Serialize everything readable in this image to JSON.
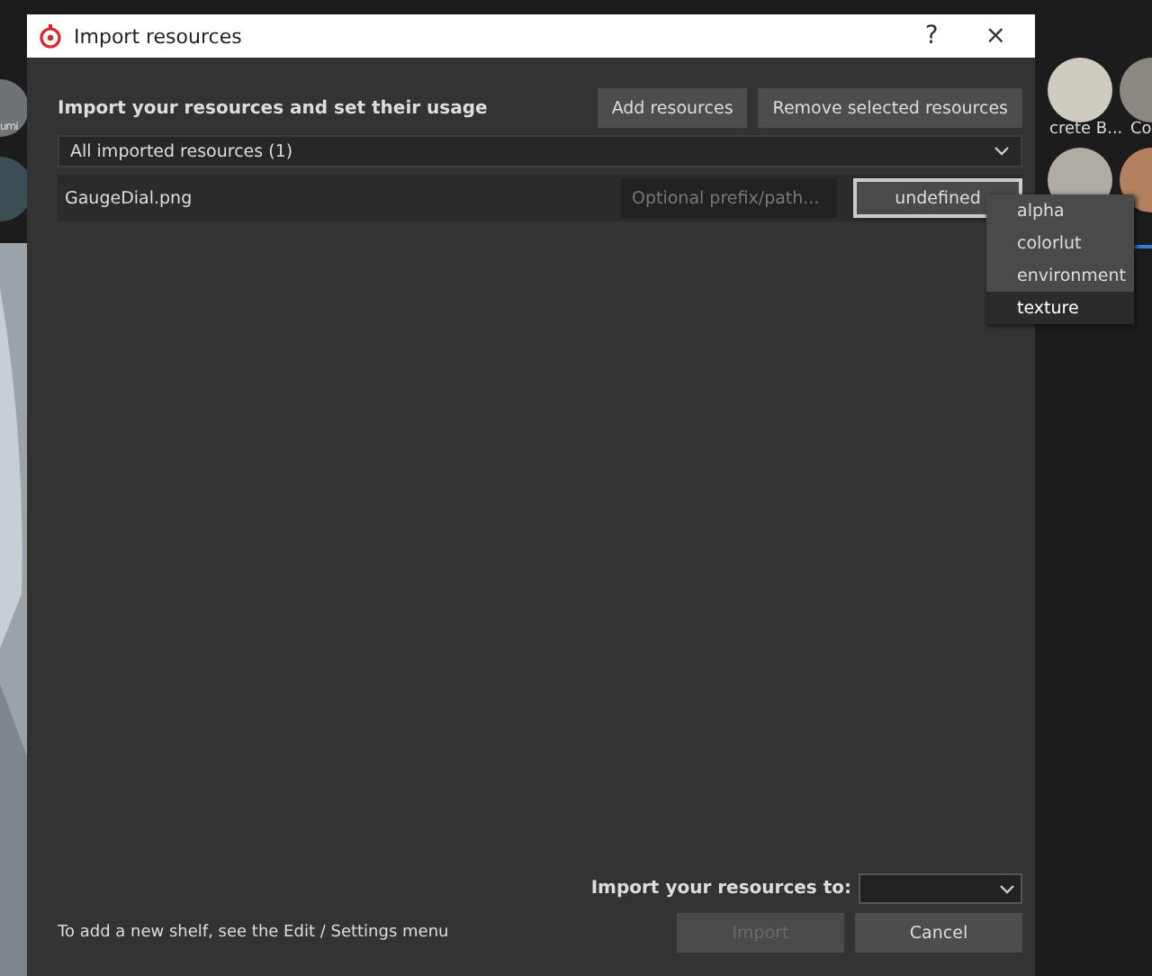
{
  "background": {
    "shelf_labels": [
      "umi",
      "crete B...",
      "Co"
    ]
  },
  "window": {
    "title": "Import resources",
    "help": "?",
    "close": "×"
  },
  "heading": "Import your resources and set their usage",
  "toolbar_buttons": [
    "Add resources",
    "Remove selected resources"
  ],
  "filter": {
    "value": "All imported resources (1)"
  },
  "resources": [
    {
      "name": "GaugeDial.png",
      "prefix_placeholder": "Optional prefix/path...",
      "usage": "undefined"
    }
  ],
  "usage_menu": [
    {
      "label": "alpha",
      "selected": false
    },
    {
      "label": "colorlut",
      "selected": false
    },
    {
      "label": "environment",
      "selected": false
    },
    {
      "label": "texture",
      "selected": true
    }
  ],
  "footer": {
    "hint": "To add a new shelf, see the Edit / Settings menu",
    "destination_label": "Import your resources to:",
    "buttons": [
      {
        "label": "Import",
        "disabled": true
      },
      {
        "label": "Cancel",
        "disabled": false
      }
    ]
  }
}
